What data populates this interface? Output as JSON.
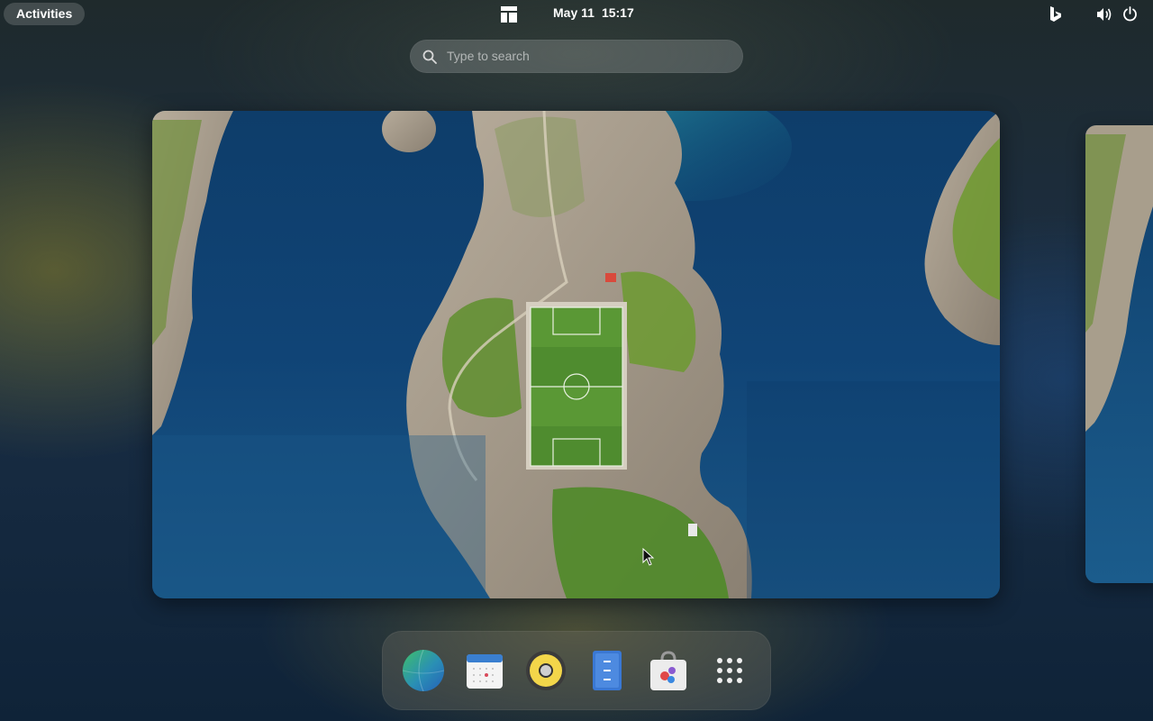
{
  "topbar": {
    "activities_label": "Activities",
    "date": "May 11",
    "time": "15:17",
    "tray": [
      "bing-icon",
      "volume-icon",
      "power-icon"
    ]
  },
  "search": {
    "placeholder": "Type to search"
  },
  "workspace": {
    "wallpaper": "aerial-football-pitch-island"
  },
  "dock": {
    "apps": [
      {
        "name": "web-browser-icon"
      },
      {
        "name": "calendar-icon"
      },
      {
        "name": "rhythmbox-icon"
      },
      {
        "name": "text-editor-icon"
      },
      {
        "name": "software-store-icon"
      },
      {
        "name": "show-apps-icon"
      }
    ]
  },
  "colors": {
    "sea": "#104476",
    "pitch": "#4f8c2f",
    "accent": "#f3d64a"
  }
}
